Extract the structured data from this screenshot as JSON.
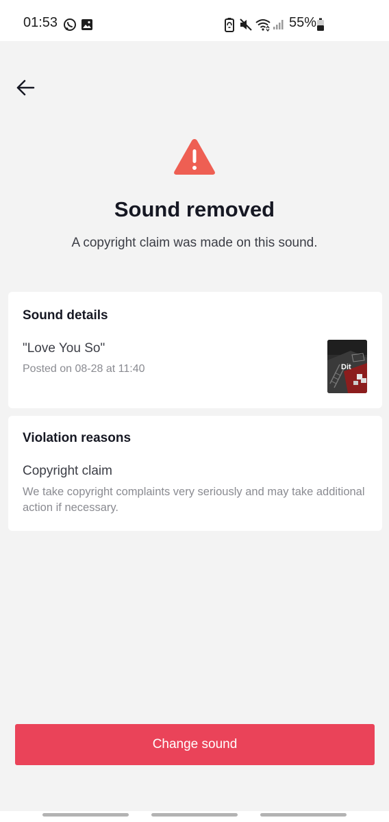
{
  "status_bar": {
    "time": "01:53",
    "battery_percent": "55%",
    "icons": [
      "whatsapp-icon",
      "gallery-icon",
      "battery-saver-icon",
      "mute-icon",
      "wifi-icon",
      "signal-icon",
      "battery-icon"
    ]
  },
  "header": {
    "back_icon": "arrow-left-icon"
  },
  "hero": {
    "icon": "warning-icon",
    "title": "Sound removed",
    "subtitle": "A copyright claim was made on this sound."
  },
  "sound_details": {
    "heading": "Sound details",
    "sound_title": "\"Love You So\"",
    "posted": "Posted on 08-28 at 11:40",
    "thumbnail_label": "Dit"
  },
  "violation": {
    "heading": "Violation reasons",
    "title": "Copyright claim",
    "description": "We take copyright complaints very seriously and may take additional action if necessary."
  },
  "actions": {
    "change_sound_label": "Change sound"
  },
  "colors": {
    "accent": "#ea4359",
    "warning": "#ee5f53",
    "background": "#f3f3f3"
  }
}
